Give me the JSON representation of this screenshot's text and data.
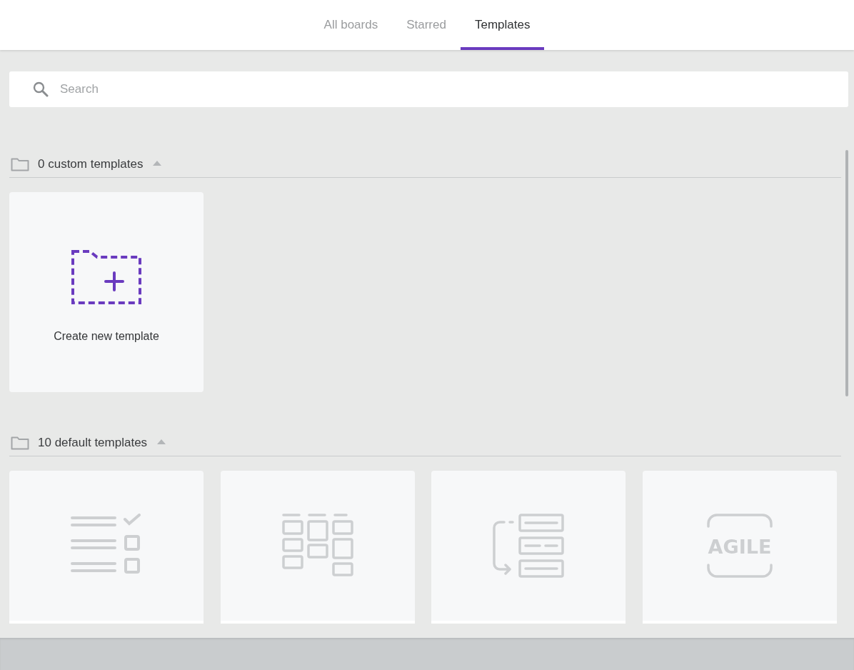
{
  "tabs": [
    {
      "label": "All boards",
      "selected": false
    },
    {
      "label": "Starred",
      "selected": false
    },
    {
      "label": "Templates",
      "selected": true
    }
  ],
  "search": {
    "placeholder": "Search"
  },
  "sections": [
    {
      "title": "0 custom templates",
      "expanded": true,
      "cards": [
        {
          "kind": "create",
          "label": "Create new template"
        }
      ]
    },
    {
      "title": "10 default templates",
      "expanded": true,
      "cards": [
        {
          "kind": "checklist"
        },
        {
          "kind": "kanban"
        },
        {
          "kind": "flow"
        },
        {
          "kind": "agile",
          "icon_text": "AGILE"
        }
      ]
    }
  ]
}
